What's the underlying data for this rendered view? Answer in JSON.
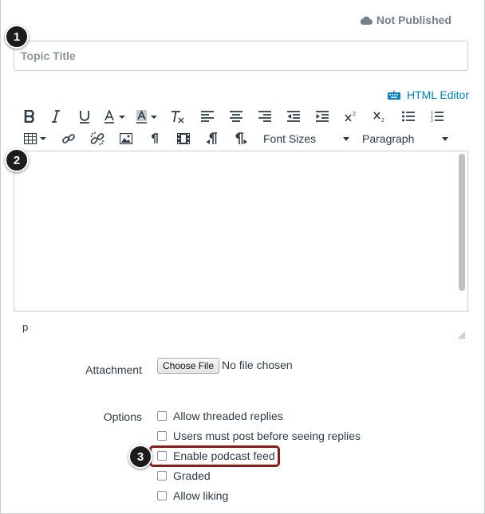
{
  "status": {
    "label": "Not Published",
    "icon": "cloud-icon"
  },
  "title_input": {
    "placeholder": "Topic Title",
    "value": ""
  },
  "callouts": [
    "1",
    "2",
    "3"
  ],
  "editor": {
    "html_editor_label": "HTML Editor",
    "font_sizes_label": "Font Sizes",
    "paragraph_label": "Paragraph",
    "path": "p"
  },
  "attachment": {
    "label": "Attachment",
    "button": "Choose File",
    "status": "No file chosen"
  },
  "options": {
    "label": "Options",
    "items": [
      {
        "label": "Allow threaded replies",
        "checked": false
      },
      {
        "label": "Users must post before seeing replies",
        "checked": false
      },
      {
        "label": "Enable podcast feed",
        "checked": false
      },
      {
        "label": "Graded",
        "checked": false
      },
      {
        "label": "Allow liking",
        "checked": false
      }
    ]
  },
  "colors": {
    "link": "#0081bd",
    "highlight": "#8b1b1b",
    "callout": "#1c1c1c",
    "text": "#2d3b45"
  }
}
